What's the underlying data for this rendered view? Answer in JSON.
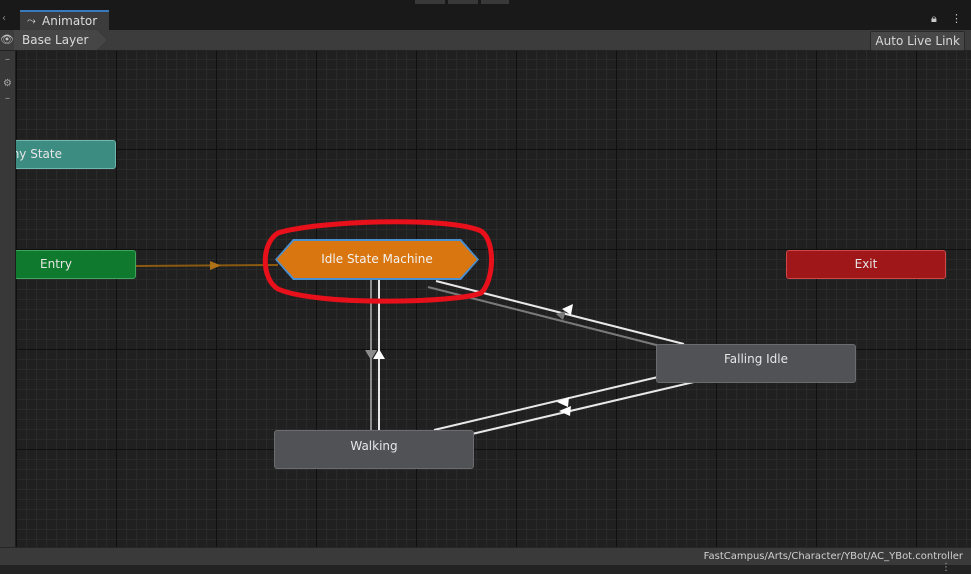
{
  "window": {
    "tab_title": "Animator",
    "tab_icon": "animator-graph-icon"
  },
  "toolbar": {
    "layer_breadcrumb": "Base Layer",
    "auto_live_link": "Auto Live Link",
    "eye_icon": "eye-icon"
  },
  "graph": {
    "nodes": {
      "any_state": "ny State",
      "entry": "Entry",
      "idle_state_machine": "Idle State Machine",
      "exit": "Exit",
      "falling_idle": "Falling Idle",
      "walking": "Walking"
    },
    "highlight_color": "#e8101a",
    "colors": {
      "entry": "#0f7a2e",
      "exit": "#a0171a",
      "any_state": "#3d8c82",
      "state_machine": "#d9760f",
      "state": "#505255",
      "selection": "#4a8fcf"
    }
  },
  "status": {
    "asset_path": "FastCampus/Arts/Character/YBot/AC_YBot.controller"
  }
}
